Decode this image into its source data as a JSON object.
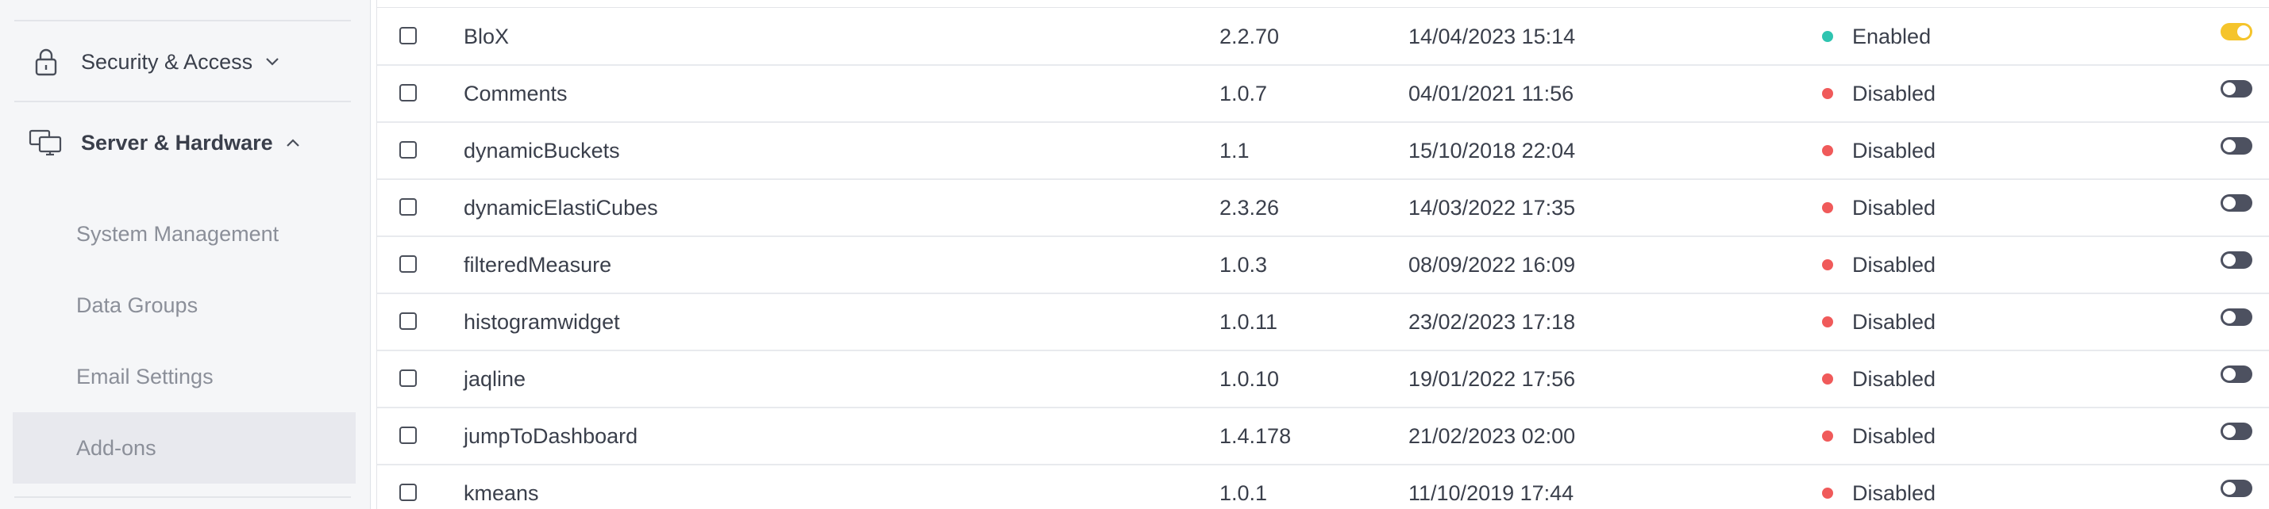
{
  "sidebar": {
    "security": {
      "label": "Security & Access",
      "icon": "lock-icon",
      "chevron": "chevron-down-icon"
    },
    "server": {
      "label": "Server & Hardware",
      "icon": "monitors-icon",
      "chevron": "chevron-up-icon",
      "items": [
        {
          "label": "System Management"
        },
        {
          "label": "Data Groups"
        },
        {
          "label": "Email Settings"
        },
        {
          "label": "Add-ons",
          "active": true
        }
      ]
    }
  },
  "colors": {
    "enabled_dot": "#2ec4b0",
    "disabled_dot": "#f05a5a",
    "toggle_on": "#f5c42b",
    "toggle_off": "#4d5160",
    "active_item_bg": "#e8e9ee"
  },
  "addons": {
    "rows": [
      {
        "name": "BloX",
        "version": "2.2.70",
        "date": "14/04/2023 15:14",
        "status": "Enabled",
        "enabled": true
      },
      {
        "name": "Comments",
        "version": "1.0.7",
        "date": "04/01/2021 11:56",
        "status": "Disabled",
        "enabled": false
      },
      {
        "name": "dynamicBuckets",
        "version": "1.1",
        "date": "15/10/2018 22:04",
        "status": "Disabled",
        "enabled": false
      },
      {
        "name": "dynamicElastiCubes",
        "version": "2.3.26",
        "date": "14/03/2022 17:35",
        "status": "Disabled",
        "enabled": false
      },
      {
        "name": "filteredMeasure",
        "version": "1.0.3",
        "date": "08/09/2022 16:09",
        "status": "Disabled",
        "enabled": false
      },
      {
        "name": "histogramwidget",
        "version": "1.0.11",
        "date": "23/02/2023 17:18",
        "status": "Disabled",
        "enabled": false
      },
      {
        "name": "jaqline",
        "version": "1.0.10",
        "date": "19/01/2022 17:56",
        "status": "Disabled",
        "enabled": false
      },
      {
        "name": "jumpToDashboard",
        "version": "1.4.178",
        "date": "21/02/2023 02:00",
        "status": "Disabled",
        "enabled": false
      },
      {
        "name": "kmeans",
        "version": "1.0.1",
        "date": "11/10/2019 17:44",
        "status": "Disabled",
        "enabled": false
      }
    ]
  }
}
